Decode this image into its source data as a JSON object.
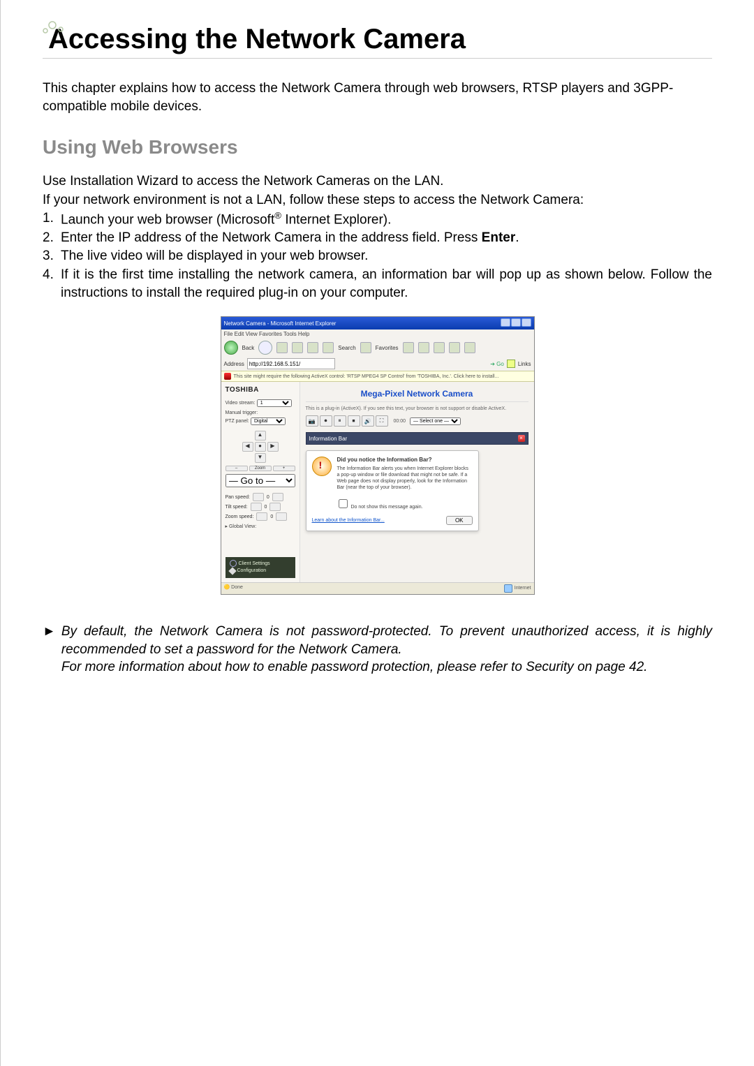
{
  "heading": {
    "chapter_title": "Accessing the Network Camera",
    "intro": "This chapter explains how to access the Network Camera through web browsers, RTSP players and 3GPP-compatible mobile devices."
  },
  "section_using_web_browsers": {
    "title": "Using Web Browsers",
    "p1": "Use Installation Wizard to access the Network Cameras on the LAN.",
    "p2": "If your network environment is not a LAN, follow these steps to access the Network Camera:",
    "steps": {
      "s1_pre": "Launch your web browser (Microsoft",
      "s1_reg": "®",
      "s1_post": " Internet Explorer).",
      "s2_pre": "Enter the IP address of the Network Camera in the address field. Press ",
      "s2_bold": "Enter",
      "s2_post": ".",
      "s3": "The live video will be displayed in your web browser.",
      "s4": "If it is the first time installing the network camera, an information bar will pop up as shown below. Follow the instructions to install the required plug-in on your computer."
    }
  },
  "screenshot": {
    "ie_title": "Network Camera - Microsoft Internet Explorer",
    "menubar": "File  Edit  View  Favorites  Tools  Help",
    "toolbar": {
      "back": "Back",
      "search": "Search",
      "favorites": "Favorites"
    },
    "address_label": "Address",
    "address_value": "http://192.168.5.151/",
    "go_label": "Go",
    "links_label": "Links",
    "infobar_text": "This site might require the following ActiveX control: 'RTSP MPEG4 SP Control' from 'TOSHIBA, Inc.'.  Click here to install...",
    "sidebar": {
      "brand": "TOSHIBA",
      "video_stream_label": "Video stream:",
      "video_stream_value": "1",
      "manual_trigger_label": "Manual trigger:",
      "ptz_panel_label": "PTZ panel:",
      "ptz_panel_value": "Digital",
      "goto_label": "— Go to —",
      "pan_speed_label": "Pan speed:",
      "pan_speed_value": "0",
      "tilt_speed_label": "Tilt speed:",
      "tilt_speed_value": "0",
      "zoom_speed_label": "Zoom speed:",
      "zoom_speed_value": "0",
      "global_view_label": "Global View:",
      "client_settings": "Client Settings",
      "configuration": "Configuration"
    },
    "main": {
      "page_title": "Mega-Pixel Network Camera",
      "plugin_notice": "This is a plug-in (ActiveX). If you see this text, your browser is not support or disable ActiveX.",
      "time": "00:00",
      "stream_select": "— Select one —",
      "video_header": "Information Bar"
    },
    "dialog": {
      "heading": "Did you notice the Information Bar?",
      "body": "The Information Bar alerts you when Internet Explorer blocks a pop-up window or file download that might not be safe. If a Web page does not display properly, look for the Information Bar (near the top of your browser).",
      "checkbox_label": "Do not show this message again.",
      "learn_link": "Learn about the Information Bar...",
      "ok": "OK"
    },
    "status_left": "Done",
    "status_right": "Internet"
  },
  "notes": {
    "n1": "By default, the Network Camera is not password-protected. To prevent unauthorized access, it is highly recommended to set a password for the Network Camera.",
    "n2": "For more information about how to enable password protection, please refer to Security on page 42."
  }
}
